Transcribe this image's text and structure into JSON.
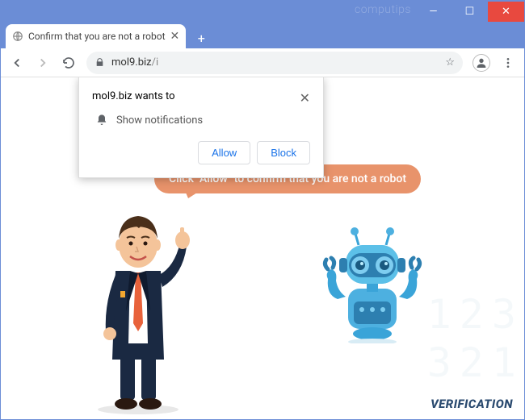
{
  "window": {
    "watermark": "computips"
  },
  "tab": {
    "title": "Confirm that you are not a robot"
  },
  "url": {
    "host": "mol9.biz",
    "path": "/i"
  },
  "permission": {
    "site": "mol9.biz wants to",
    "label": "Show notifications",
    "allow": "Allow",
    "block": "Block"
  },
  "bubble": {
    "text": "Click \"Allow\" to confirm that you are not a robot"
  },
  "footer": {
    "verification": "VERIFICATION"
  }
}
